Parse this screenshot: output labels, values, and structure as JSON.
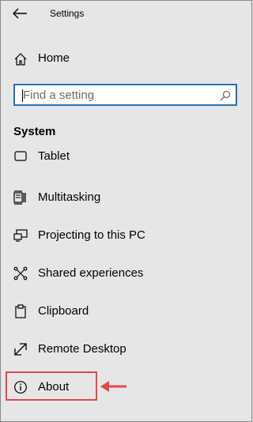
{
  "window": {
    "title": "Settings"
  },
  "home": {
    "label": "Home"
  },
  "search": {
    "placeholder": "Find a setting"
  },
  "section": {
    "heading": "System"
  },
  "nav": {
    "items": [
      {
        "label": "Tablet",
        "icon": "tablet-icon"
      },
      {
        "label": "Multitasking",
        "icon": "multitasking-icon"
      },
      {
        "label": "Projecting to this PC",
        "icon": "projecting-icon"
      },
      {
        "label": "Shared experiences",
        "icon": "shared-experiences-icon"
      },
      {
        "label": "Clipboard",
        "icon": "clipboard-icon"
      },
      {
        "label": "Remote Desktop",
        "icon": "remote-desktop-icon"
      },
      {
        "label": "About",
        "icon": "info-icon"
      }
    ]
  },
  "colors": {
    "accent": "#1e73be",
    "annotation": "#e0484f",
    "background": "#e6e6e6"
  }
}
